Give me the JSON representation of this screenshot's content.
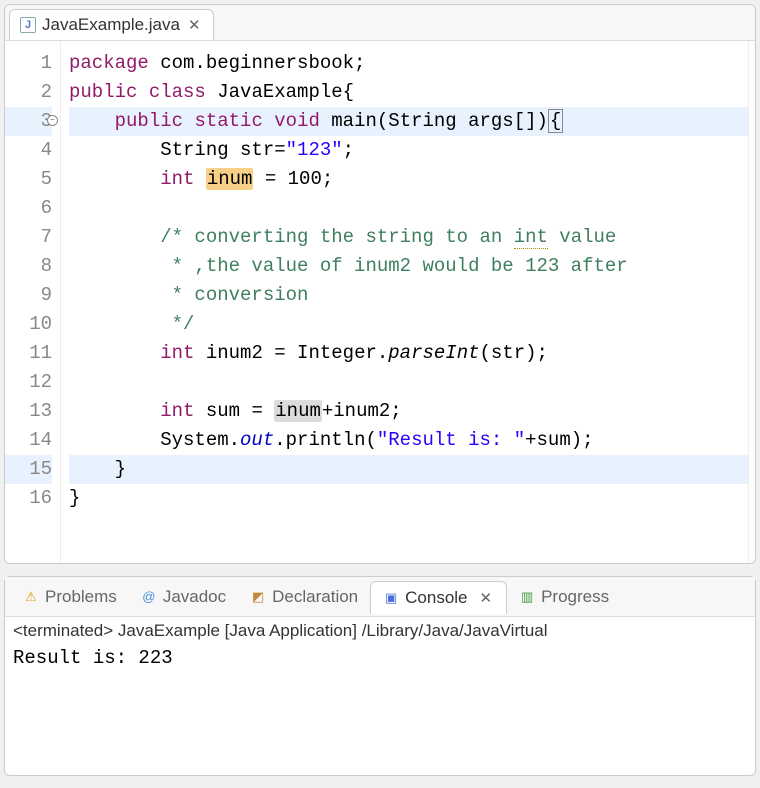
{
  "editor": {
    "tab": {
      "filename": "JavaExample.java"
    },
    "lines": [
      {
        "n": 1,
        "tokens": [
          [
            "kw",
            "package"
          ],
          [
            "",
            " com.beginnersbook;"
          ]
        ]
      },
      {
        "n": 2,
        "tokens": [
          [
            "kw",
            "public"
          ],
          [
            "",
            " "
          ],
          [
            "kw",
            "class"
          ],
          [
            "",
            " JavaExample{"
          ]
        ]
      },
      {
        "n": 3,
        "fold": true,
        "hl": true,
        "tokens": [
          [
            "",
            "    "
          ],
          [
            "kw",
            "public"
          ],
          [
            "",
            " "
          ],
          [
            "kw",
            "static"
          ],
          [
            "",
            " "
          ],
          [
            "kw",
            "void"
          ],
          [
            "",
            " main(String args[])"
          ],
          [
            "bracket",
            "{"
          ]
        ]
      },
      {
        "n": 4,
        "tokens": [
          [
            "",
            "        String str="
          ],
          [
            "str",
            "\"123\""
          ],
          [
            "",
            ";"
          ]
        ]
      },
      {
        "n": 5,
        "tokens": [
          [
            "",
            "        "
          ],
          [
            "kw",
            "int"
          ],
          [
            "",
            " "
          ],
          [
            "occw",
            "inum"
          ],
          [
            "",
            " = 100;"
          ]
        ]
      },
      {
        "n": 6,
        "tokens": [
          [
            "",
            ""
          ]
        ]
      },
      {
        "n": 7,
        "tokens": [
          [
            "",
            "        "
          ],
          [
            "cmt",
            "/* converting the string to an "
          ],
          [
            "cmtu",
            "int"
          ],
          [
            "cmt",
            " value"
          ]
        ]
      },
      {
        "n": 8,
        "tokens": [
          [
            "",
            "        "
          ],
          [
            "cmt",
            " * ,the value of inum2 would be 123 after"
          ]
        ]
      },
      {
        "n": 9,
        "tokens": [
          [
            "",
            "        "
          ],
          [
            "cmt",
            " * conversion"
          ]
        ]
      },
      {
        "n": 10,
        "tokens": [
          [
            "",
            "        "
          ],
          [
            "cmt",
            " */"
          ]
        ]
      },
      {
        "n": 11,
        "tokens": [
          [
            "",
            "        "
          ],
          [
            "kw",
            "int"
          ],
          [
            "",
            " inum2 = Integer."
          ],
          [
            "mi",
            "parseInt"
          ],
          [
            "",
            "(str);"
          ]
        ]
      },
      {
        "n": 12,
        "tokens": [
          [
            "",
            ""
          ]
        ]
      },
      {
        "n": 13,
        "tokens": [
          [
            "",
            "        "
          ],
          [
            "kw",
            "int"
          ],
          [
            "",
            " sum = "
          ],
          [
            "occr",
            "inum"
          ],
          [
            "",
            "+inum2;"
          ]
        ]
      },
      {
        "n": 14,
        "tokens": [
          [
            "",
            "        System."
          ],
          [
            "field",
            "out"
          ],
          [
            "",
            ".println("
          ],
          [
            "str",
            "\"Result is: \""
          ],
          [
            "",
            "+sum);"
          ]
        ]
      },
      {
        "n": 15,
        "hl": true,
        "tokens": [
          [
            "",
            "    }"
          ]
        ]
      },
      {
        "n": 16,
        "tokens": [
          [
            "",
            "}"
          ]
        ]
      }
    ]
  },
  "bottomTabs": {
    "problems": "Problems",
    "javadoc": "Javadoc",
    "declaration": "Declaration",
    "console": "Console",
    "progress": "Progress"
  },
  "console": {
    "status": "<terminated> JavaExample [Java Application] /Library/Java/JavaVirtual",
    "output": "Result is: 223"
  }
}
